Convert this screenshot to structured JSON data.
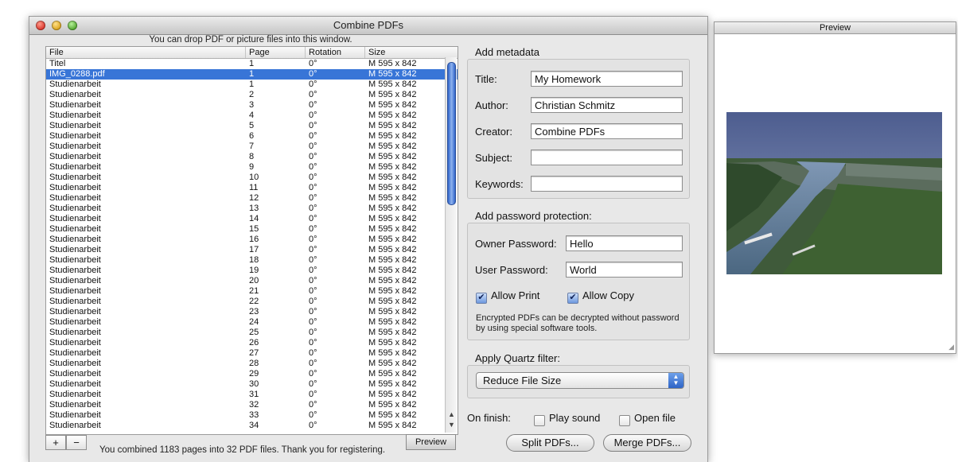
{
  "window": {
    "title": "Combine PDFs"
  },
  "drop_hint": "You can drop PDF or picture files into this window.",
  "table": {
    "columns": [
      "File",
      "Page",
      "Rotation",
      "Size"
    ],
    "rows": [
      [
        "Titel",
        "1",
        "0°",
        "M 595 x 842"
      ],
      [
        "IMG_0288.pdf",
        "1",
        "0°",
        "M 595 x 842"
      ],
      [
        "Studienarbeit",
        "1",
        "0°",
        "M 595 x 842"
      ],
      [
        "Studienarbeit",
        "2",
        "0°",
        "M 595 x 842"
      ],
      [
        "Studienarbeit",
        "3",
        "0°",
        "M 595 x 842"
      ],
      [
        "Studienarbeit",
        "4",
        "0°",
        "M 595 x 842"
      ],
      [
        "Studienarbeit",
        "5",
        "0°",
        "M 595 x 842"
      ],
      [
        "Studienarbeit",
        "6",
        "0°",
        "M 595 x 842"
      ],
      [
        "Studienarbeit",
        "7",
        "0°",
        "M 595 x 842"
      ],
      [
        "Studienarbeit",
        "8",
        "0°",
        "M 595 x 842"
      ],
      [
        "Studienarbeit",
        "9",
        "0°",
        "M 595 x 842"
      ],
      [
        "Studienarbeit",
        "10",
        "0°",
        "M 595 x 842"
      ],
      [
        "Studienarbeit",
        "11",
        "0°",
        "M 595 x 842"
      ],
      [
        "Studienarbeit",
        "12",
        "0°",
        "M 595 x 842"
      ],
      [
        "Studienarbeit",
        "13",
        "0°",
        "M 595 x 842"
      ],
      [
        "Studienarbeit",
        "14",
        "0°",
        "M 595 x 842"
      ],
      [
        "Studienarbeit",
        "15",
        "0°",
        "M 595 x 842"
      ],
      [
        "Studienarbeit",
        "16",
        "0°",
        "M 595 x 842"
      ],
      [
        "Studienarbeit",
        "17",
        "0°",
        "M 595 x 842"
      ],
      [
        "Studienarbeit",
        "18",
        "0°",
        "M 595 x 842"
      ],
      [
        "Studienarbeit",
        "19",
        "0°",
        "M 595 x 842"
      ],
      [
        "Studienarbeit",
        "20",
        "0°",
        "M 595 x 842"
      ],
      [
        "Studienarbeit",
        "21",
        "0°",
        "M 595 x 842"
      ],
      [
        "Studienarbeit",
        "22",
        "0°",
        "M 595 x 842"
      ],
      [
        "Studienarbeit",
        "23",
        "0°",
        "M 595 x 842"
      ],
      [
        "Studienarbeit",
        "24",
        "0°",
        "M 595 x 842"
      ],
      [
        "Studienarbeit",
        "25",
        "0°",
        "M 595 x 842"
      ],
      [
        "Studienarbeit",
        "26",
        "0°",
        "M 595 x 842"
      ],
      [
        "Studienarbeit",
        "27",
        "0°",
        "M 595 x 842"
      ],
      [
        "Studienarbeit",
        "28",
        "0°",
        "M 595 x 842"
      ],
      [
        "Studienarbeit",
        "29",
        "0°",
        "M 595 x 842"
      ],
      [
        "Studienarbeit",
        "30",
        "0°",
        "M 595 x 842"
      ],
      [
        "Studienarbeit",
        "31",
        "0°",
        "M 595 x 842"
      ],
      [
        "Studienarbeit",
        "32",
        "0°",
        "M 595 x 842"
      ],
      [
        "Studienarbeit",
        "33",
        "0°",
        "M 595 x 842"
      ],
      [
        "Studienarbeit",
        "34",
        "0°",
        "M 595 x 842"
      ]
    ],
    "selected_row": 1
  },
  "buttons": {
    "add": "+",
    "remove": "−",
    "preview": "Preview",
    "split": "Split PDFs...",
    "merge": "Merge PDFs..."
  },
  "status": "You combined 1183 pages into 32 PDF files. Thank you for registering.",
  "metadata": {
    "heading": "Add metadata",
    "title_label": "Title:",
    "title_value": "My Homework",
    "author_label": "Author:",
    "author_value": "Christian Schmitz",
    "creator_label": "Creator:",
    "creator_value": "Combine PDFs",
    "subject_label": "Subject:",
    "subject_value": "",
    "keywords_label": "Keywords:",
    "keywords_value": ""
  },
  "password": {
    "heading": "Add password protection:",
    "owner_label": "Owner Password:",
    "owner_value": "Hello",
    "user_label": "User Password:",
    "user_value": "World",
    "allow_print": "Allow Print",
    "allow_print_checked": true,
    "allow_copy": "Allow Copy",
    "allow_copy_checked": true,
    "note": "Encrypted PDFs can be decrypted without password by using special software tools."
  },
  "quartz": {
    "heading": "Apply Quartz filter:",
    "selected": "Reduce File Size"
  },
  "finish": {
    "label": "On finish:",
    "play_sound": "Play sound",
    "play_sound_checked": false,
    "open_file": "Open file",
    "open_file_checked": false
  },
  "preview_window": {
    "title": "Preview"
  },
  "colors": {
    "selection": "#3875d7",
    "scroll_thumb": "#4a7fdc"
  }
}
